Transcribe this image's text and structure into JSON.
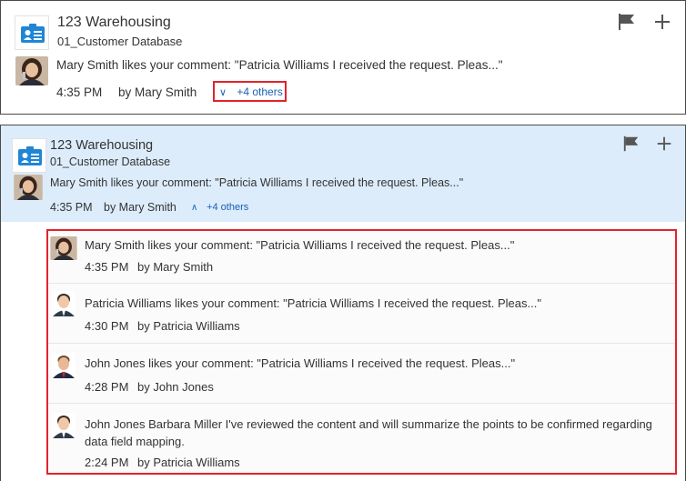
{
  "top_card": {
    "app_name": "123 Warehousing",
    "app_sub": "01_Customer Database",
    "message": "Mary Smith likes your comment: \"Patricia Williams I received the request. Pleas...\"",
    "time": "4:35 PM",
    "by": "by Mary Smith",
    "others_label": "+4 others",
    "others_chevron": "∨"
  },
  "bottom_card": {
    "app_name": "123 Warehousing",
    "app_sub": "01_Customer Database",
    "message": "Mary Smith likes your comment: \"Patricia Williams I received the request. Pleas...\"",
    "time": "4:35 PM",
    "by": "by Mary Smith",
    "others_label": "+4 others",
    "others_chevron": "∧",
    "items": [
      {
        "message": "Mary Smith likes your comment: \"Patricia Williams I received the request. Pleas...\"",
        "time": "4:35 PM",
        "by": "by Mary Smith",
        "avatar": "woman-avatar"
      },
      {
        "message": "Patricia Williams likes your comment: \"Patricia Williams I received the request. Pleas...\"",
        "time": "4:30 PM",
        "by": "by Patricia Williams",
        "avatar": "young-man-avatar"
      },
      {
        "message": "John Jones likes your comment: \"Patricia Williams I received the request. Pleas...\"",
        "time": "4:28 PM",
        "by": "by John Jones",
        "avatar": "man-avatar"
      },
      {
        "message": "John Jones Barbara Miller I've reviewed the content and will summarize the points to be confirmed regarding data field mapping.",
        "time": "2:24 PM",
        "by": "by Patricia Williams",
        "avatar": "young-man-avatar"
      }
    ]
  },
  "icons": {
    "app": "address-card-icon",
    "flag": "flag-icon",
    "add": "plus-icon"
  },
  "colors": {
    "accent_link": "#1a5fb4",
    "highlight_border": "#e0242c",
    "expanded_header": "#dcecfb",
    "app_icon_blue": "#1f86d6"
  }
}
